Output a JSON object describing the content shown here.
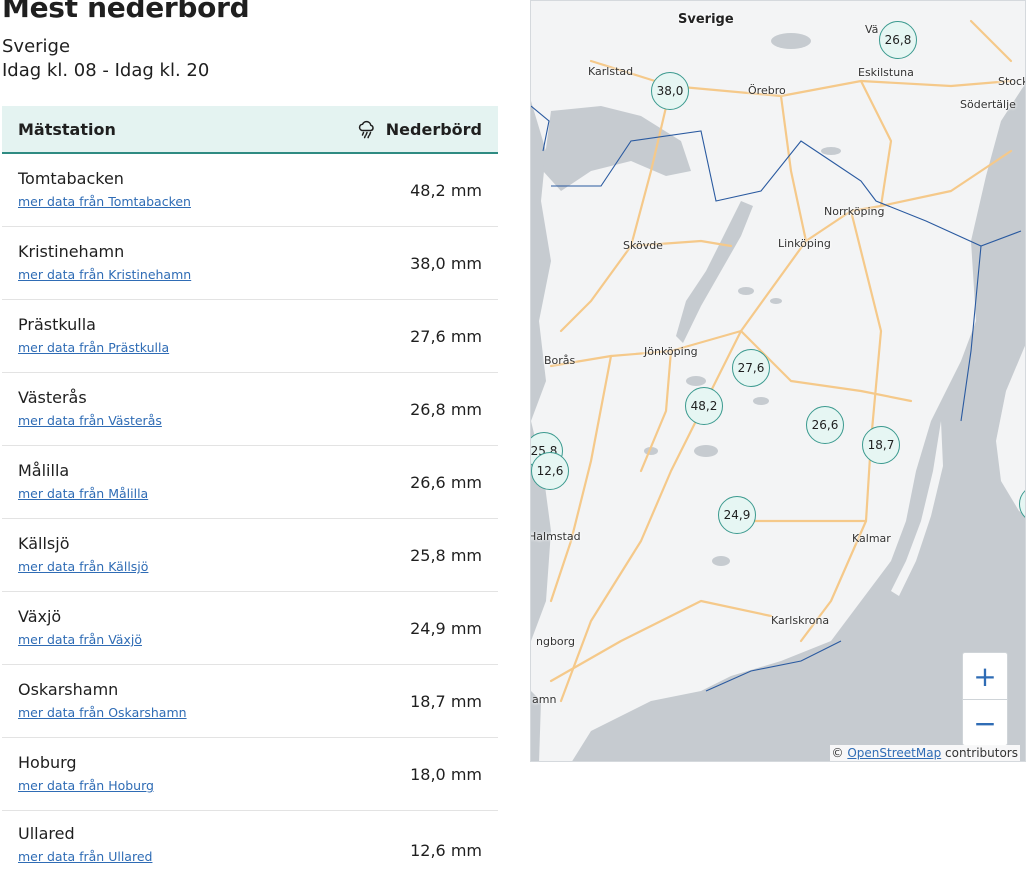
{
  "header": {
    "title": "Mest nederbörd",
    "region": "Sverige",
    "period": "Idag kl. 08 - Idag kl. 20"
  },
  "table": {
    "col_station": "Mätstation",
    "col_value": "Nederbörd",
    "col_value_icon": "rain-cloud-icon",
    "rows": [
      {
        "name": "Tomtabacken",
        "link": "mer data från Tomtabacken",
        "value": "48,2 mm"
      },
      {
        "name": "Kristinehamn",
        "link": "mer data från Kristinehamn",
        "value": "38,0 mm"
      },
      {
        "name": "Prästkulla",
        "link": "mer data från Prästkulla",
        "value": "27,6 mm"
      },
      {
        "name": "Västerås",
        "link": "mer data från Västerås",
        "value": "26,8 mm"
      },
      {
        "name": "Målilla",
        "link": "mer data från Målilla",
        "value": "26,6 mm"
      },
      {
        "name": "Källsjö",
        "link": "mer data från Källsjö",
        "value": "25,8 mm"
      },
      {
        "name": "Växjö",
        "link": "mer data från Växjö",
        "value": "24,9 mm"
      },
      {
        "name": "Oskarshamn",
        "link": "mer data från Oskarshamn",
        "value": "18,7 mm"
      },
      {
        "name": "Hoburg",
        "link": "mer data från Hoburg",
        "value": "18,0 mm"
      },
      {
        "name": "Ullared",
        "link": "mer data från Ullared",
        "value": "12,6 mm"
      }
    ]
  },
  "map": {
    "cities": {
      "sverige": "Sverige",
      "karlstad": "Karlstad",
      "orebro": "Örebro",
      "eskilstuna": "Eskilstuna",
      "stockholm": "Stock",
      "sodertalje": "Södertälje",
      "vasteras": "Vä",
      "norrkoping": "Norrköping",
      "skovde": "Skövde",
      "linkoping": "Linköping",
      "jonkoping": "Jönköping",
      "boras": "Borås",
      "halmstad": "Halmstad",
      "kalmar": "Kalmar",
      "karlskrona": "Karlskrona",
      "helsingborg": "ngborg",
      "malmo": "amn"
    },
    "markers": {
      "m268": "26,8",
      "m380": "38,0",
      "m276": "27,6",
      "m482": "48,2",
      "m266": "26,6",
      "m187": "18,7",
      "m258": "25,8",
      "m126": "12,6",
      "m249": "24,9"
    },
    "zoom_in": "+",
    "zoom_out": "−",
    "attribution_prefix": "©",
    "attribution_link": "OpenStreetMap",
    "attribution_suffix": "contributors",
    "colors": {
      "water": "#c6cbd0",
      "land": "#f3f4f5",
      "road": "#f5c98a",
      "border": "#2a5aa0",
      "marker_border": "#3b9a8f",
      "marker_fill": "#e6f6f3"
    }
  }
}
